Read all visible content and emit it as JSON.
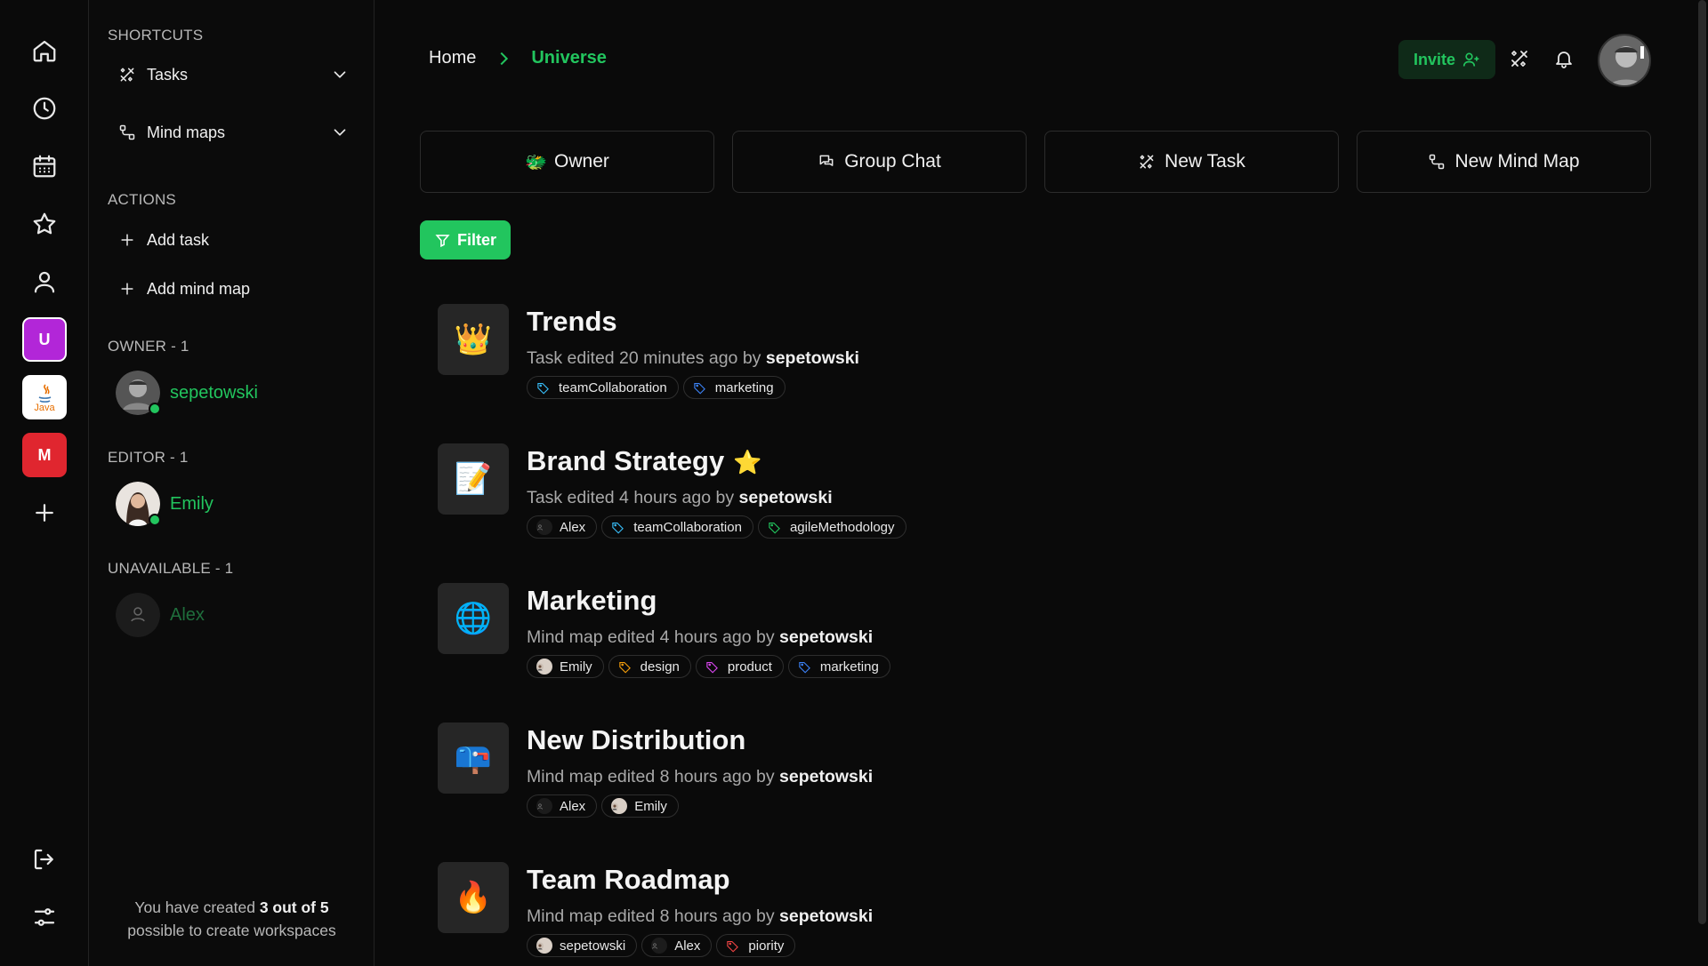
{
  "rail": {
    "nav_icons": [
      "home-icon",
      "clock-icon",
      "calendar-icon",
      "star-icon",
      "user-icon"
    ],
    "workspaces": [
      {
        "label": "U",
        "color": "#b226d8"
      },
      {
        "label": "Java",
        "color": "#ffffff"
      },
      {
        "label": "M",
        "color": "#e0262f"
      }
    ],
    "add_icon": "plus-icon",
    "bottom_icons": [
      "logout-icon",
      "settings-sliders-icon"
    ]
  },
  "sidebar": {
    "shortcuts_title": "SHORTCUTS",
    "shortcuts": [
      {
        "label": "Tasks",
        "icon": "tasks-icon"
      },
      {
        "label": "Mind maps",
        "icon": "mindmap-icon"
      }
    ],
    "actions_title": "ACTIONS",
    "actions": [
      {
        "label": "Add task"
      },
      {
        "label": "Add mind map"
      }
    ],
    "owner_title": "OWNER - 1",
    "owner": {
      "name": "sepetowski"
    },
    "editor_title": "EDITOR - 1",
    "editor": {
      "name": "Emily"
    },
    "unavailable_title": "UNAVAILABLE - 1",
    "unavailable": {
      "name": "Alex"
    },
    "footer_prefix": "You have created ",
    "footer_bold": "3 out of 5",
    "footer_suffix": "possible to create workspaces"
  },
  "header": {
    "home": "Home",
    "current": "Universe",
    "invite": "Invite"
  },
  "actions": [
    {
      "label": "Owner",
      "emoji": "🐲"
    },
    {
      "label": "Group Chat",
      "icon": "chat-icon"
    },
    {
      "label": "New Task",
      "icon": "tasks-icon"
    },
    {
      "label": "New Mind Map",
      "icon": "mindmap-icon"
    }
  ],
  "filter_label": "Filter",
  "items": [
    {
      "emoji": "👑",
      "title": "Trends",
      "starred": false,
      "sub": "Task edited 20 minutes ago by ",
      "author": "sepetowski",
      "tags": [
        {
          "kind": "tag",
          "label": "teamCollaboration",
          "color": "#38bdf8"
        },
        {
          "kind": "tag",
          "label": "marketing",
          "color": "#3b82f6"
        }
      ]
    },
    {
      "emoji": "📝",
      "title": "Brand Strategy",
      "starred": true,
      "star": "⭐",
      "sub": "Task edited 4 hours ago by ",
      "author": "sepetowski",
      "tags": [
        {
          "kind": "user",
          "label": "Alex"
        },
        {
          "kind": "tag",
          "label": "teamCollaboration",
          "color": "#38bdf8"
        },
        {
          "kind": "tag",
          "label": "agileMethodology",
          "color": "#22c55e"
        }
      ]
    },
    {
      "emoji": "🌐",
      "title": "Marketing",
      "starred": false,
      "sub": "Mind map edited 4 hours ago by ",
      "author": "sepetowski",
      "tags": [
        {
          "kind": "user",
          "label": "Emily",
          "photo": true
        },
        {
          "kind": "tag",
          "label": "design",
          "color": "#f59e0b"
        },
        {
          "kind": "tag",
          "label": "product",
          "color": "#d946ef"
        },
        {
          "kind": "tag",
          "label": "marketing",
          "color": "#3b82f6"
        }
      ]
    },
    {
      "emoji": "📪",
      "title": "New Distribution",
      "starred": false,
      "sub": "Mind map edited 8 hours ago by ",
      "author": "sepetowski",
      "tags": [
        {
          "kind": "user",
          "label": "Alex"
        },
        {
          "kind": "user",
          "label": "Emily",
          "photo": true
        }
      ]
    },
    {
      "emoji": "🔥",
      "title": "Team Roadmap",
      "starred": false,
      "sub": "Mind map edited 8 hours ago by ",
      "author": "sepetowski",
      "tags": [
        {
          "kind": "user",
          "label": "sepetowski",
          "photo": true
        },
        {
          "kind": "user",
          "label": "Alex"
        },
        {
          "kind": "tag",
          "label": "piority",
          "color": "#ef4444"
        }
      ]
    }
  ]
}
